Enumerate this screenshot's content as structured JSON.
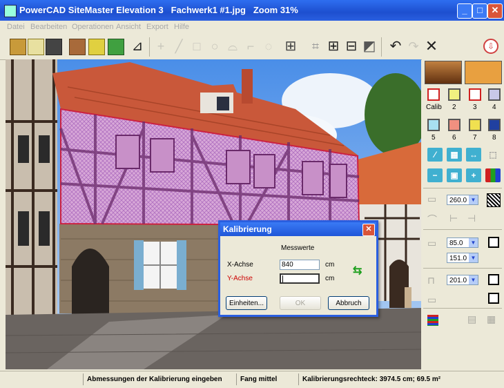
{
  "window": {
    "title": "PowerCAD SiteMaster Elevation 3   Fachwerk1 #1.jpg   Zoom 31%"
  },
  "menu": [
    "Datei",
    "Bearbeiten",
    "Operationen",
    "Ansicht",
    "Export",
    "Hilfe"
  ],
  "sidebar": {
    "swatch_labels": [
      "Calib",
      "2",
      "3",
      "4",
      "5",
      "6",
      "7",
      "8"
    ],
    "spinners": [
      "260.0",
      "85.0",
      "151.0",
      "201.0"
    ]
  },
  "dialog": {
    "title": "Kalibrierung",
    "header": "Messwerte",
    "x_label": "X-Achse",
    "x_value": "840",
    "x_unit": "cm",
    "y_label": "Y-Achse",
    "y_value": "",
    "y_unit": "cm",
    "units_button": "Einheiten...",
    "ok_button": "OK",
    "cancel_button": "Abbruch",
    "colors": {
      "y_label": "#cc0000"
    }
  },
  "status": {
    "hint": "Abmessungen der Kalibrierung eingeben",
    "snap": "Fang mittel",
    "calib_rect": "Kalibrierungsrechteck: 3974.5 cm; 69.5 m²"
  }
}
